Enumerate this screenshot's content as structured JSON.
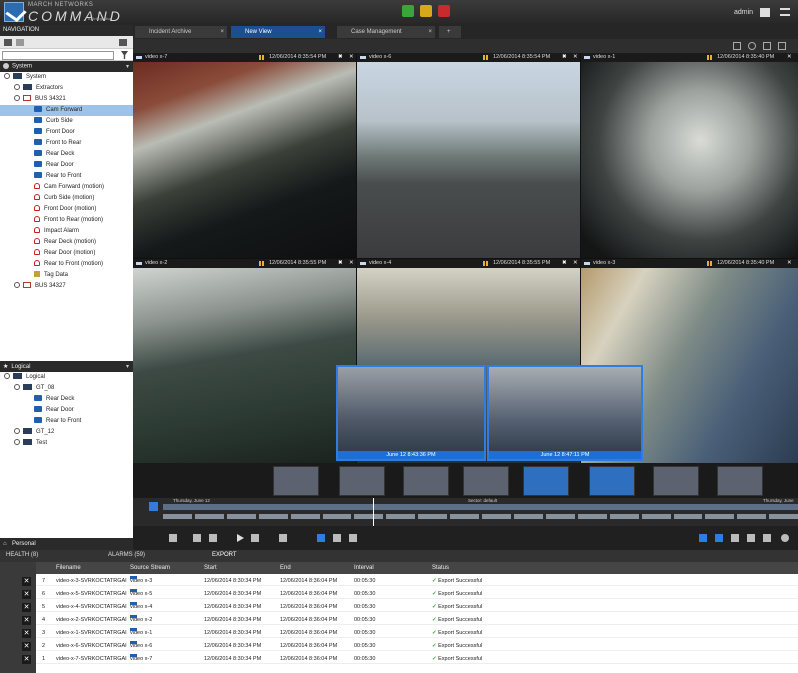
{
  "app": {
    "brand_small": "MARCH NETWORKS",
    "brand_big": "COMMAND",
    "brand_tag": "ID Integration",
    "user": "admin"
  },
  "navigation": {
    "title": "NAVIGATION",
    "system_header": "System",
    "tree": [
      {
        "label": "System",
        "type": "folder",
        "level": 0
      },
      {
        "label": "Extractors",
        "type": "folder",
        "level": 1
      },
      {
        "label": "BUS 34321",
        "type": "bus",
        "level": 1
      },
      {
        "label": "Cam Forward",
        "type": "cam",
        "level": 2,
        "selected": true
      },
      {
        "label": "Curb Side",
        "type": "cam",
        "level": 2
      },
      {
        "label": "Front Door",
        "type": "cam",
        "level": 2
      },
      {
        "label": "Front to Rear",
        "type": "cam",
        "level": 2
      },
      {
        "label": "Rear Deck",
        "type": "cam",
        "level": 2
      },
      {
        "label": "Rear Door",
        "type": "cam",
        "level": 2
      },
      {
        "label": "Rear to Front",
        "type": "cam",
        "level": 2
      },
      {
        "label": "Cam Forward (motion)",
        "type": "bell",
        "level": 2
      },
      {
        "label": "Curb Side (motion)",
        "type": "bell",
        "level": 2
      },
      {
        "label": "Front Door (motion)",
        "type": "bell",
        "level": 2
      },
      {
        "label": "Front to Rear (motion)",
        "type": "bell",
        "level": 2
      },
      {
        "label": "Impact Alarm",
        "type": "bell",
        "level": 2
      },
      {
        "label": "Rear Deck (motion)",
        "type": "bell",
        "level": 2
      },
      {
        "label": "Rear Door (motion)",
        "type": "bell",
        "level": 2
      },
      {
        "label": "Rear to Front (motion)",
        "type": "bell",
        "level": 2
      },
      {
        "label": "Tag Data",
        "type": "tag",
        "level": 2
      },
      {
        "label": "BUS 34327",
        "type": "bus",
        "level": 1
      }
    ],
    "logical_header": "Logical",
    "logical_tree": [
      {
        "label": "Logical",
        "type": "folder",
        "level": 0
      },
      {
        "label": "GT_08",
        "type": "folder",
        "level": 1
      },
      {
        "label": "Rear Deck",
        "type": "cam",
        "level": 2
      },
      {
        "label": "Rear Door",
        "type": "cam",
        "level": 2
      },
      {
        "label": "Rear to Front",
        "type": "cam",
        "level": 2
      },
      {
        "label": "GT_12",
        "type": "folder",
        "level": 1
      },
      {
        "label": "Test",
        "type": "folder",
        "level": 1
      }
    ],
    "personal_header": "Personal"
  },
  "tabs": [
    {
      "label": "Incident Archive",
      "active": false
    },
    {
      "label": "New View",
      "active": true
    },
    {
      "label": "Case Management",
      "active": false
    }
  ],
  "tiles": [
    {
      "name": "video x-7",
      "time": "12/06/2014 8:35:54 PM"
    },
    {
      "name": "video x-6",
      "time": "12/06/2014 8:35:54 PM"
    },
    {
      "name": "video x-1",
      "time": "12/06/2014 8:35:40 PM"
    },
    {
      "name": "video x-2",
      "time": "12/06/2014 8:35:55 PM"
    },
    {
      "name": "video x-4",
      "time": "12/06/2014 8:35:55 PM"
    },
    {
      "name": "video x-3",
      "time": "12/06/2014 8:35:40 PM"
    }
  ],
  "overlays": [
    {
      "caption": "June 12 8:43:36 PM"
    },
    {
      "caption": "June 12 8:47:11 PM"
    }
  ],
  "timeline": {
    "start_label": "Thursday, June 12",
    "mid_label": "Sector: default",
    "end_label": "Thursday, June"
  },
  "bottom": {
    "health": "HEALTH (8)",
    "alarms": "ALARMS (59)",
    "export": "EXPORT"
  },
  "export_table": {
    "headers": {
      "filename": "Filename",
      "source": "Source Stream",
      "start": "Start",
      "end": "End",
      "interval": "Interval",
      "status": "Status"
    },
    "rows": [
      {
        "num": "7",
        "filename": "video-x-3-SVRKOCTATRGAI",
        "source": "video x-3",
        "start": "12/06/2014 8:30:34 PM",
        "end": "12/06/2014 8:36:04 PM",
        "interval": "00:05:30",
        "status": "Export Successful"
      },
      {
        "num": "6",
        "filename": "video-x-5-SVRKOCTATRGAI",
        "source": "video x-5",
        "start": "12/06/2014 8:30:34 PM",
        "end": "12/06/2014 8:36:04 PM",
        "interval": "00:05:30",
        "status": "Export Successful"
      },
      {
        "num": "5",
        "filename": "video-x-4-SVRKOCTATRGAI",
        "source": "video x-4",
        "start": "12/06/2014 8:30:34 PM",
        "end": "12/06/2014 8:36:04 PM",
        "interval": "00:05:30",
        "status": "Export Successful"
      },
      {
        "num": "4",
        "filename": "video-x-2-SVRKOCTATRGAI",
        "source": "video x-2",
        "start": "12/06/2014 8:30:34 PM",
        "end": "12/06/2014 8:36:04 PM",
        "interval": "00:05:30",
        "status": "Export Successful"
      },
      {
        "num": "3",
        "filename": "video-x-1-SVRKOCTATRGAI",
        "source": "video x-1",
        "start": "12/06/2014 8:30:34 PM",
        "end": "12/06/2014 8:36:04 PM",
        "interval": "00:05:30",
        "status": "Export Successful"
      },
      {
        "num": "2",
        "filename": "video-x-6-SVRKOCTATRGAI",
        "source": "video x-6",
        "start": "12/06/2014 8:30:34 PM",
        "end": "12/06/2014 8:36:04 PM",
        "interval": "00:05:30",
        "status": "Export Successful"
      },
      {
        "num": "1",
        "filename": "video-x-7-SVRKOCTATRGAI",
        "source": "video x-7",
        "start": "12/06/2014 8:30:34 PM",
        "end": "12/06/2014 8:36:04 PM",
        "interval": "00:05:30",
        "status": "Export Successful"
      }
    ]
  }
}
